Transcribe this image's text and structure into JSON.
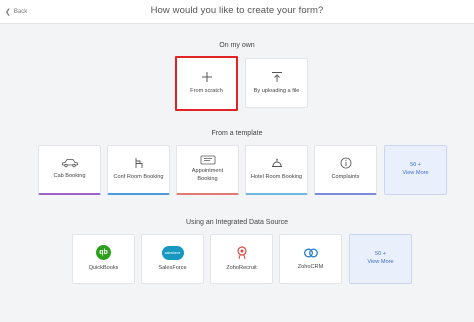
{
  "header": {
    "back_label": "Back",
    "title": "How would you like to create your form?"
  },
  "own": {
    "section_title": "On my own",
    "from_scratch": "From scratch",
    "upload": "By uploading a file"
  },
  "templates": {
    "section_title": "From a template",
    "items": [
      {
        "label": "Cab Booking",
        "icon": "car-icon"
      },
      {
        "label": "Conf Room Booking",
        "icon": "chair-icon"
      },
      {
        "label": "Appointment\nBooking",
        "icon": "ticket-icon"
      },
      {
        "label": "Hotel Room Booking",
        "icon": "bell-icon"
      },
      {
        "label": "Complaints",
        "icon": "info-icon"
      }
    ],
    "more_count": "50 +",
    "more_label": "View More"
  },
  "integrations": {
    "section_title": "Using an Integrated Data Source",
    "items": [
      {
        "label": "QuickBooks",
        "icon": "quickbooks-icon"
      },
      {
        "label": "SalesForce",
        "icon": "salesforce-icon"
      },
      {
        "label": "ZohoRecruit",
        "icon": "zohorecruit-icon"
      },
      {
        "label": "ZohoCRM",
        "icon": "zohocrm-icon"
      }
    ],
    "salesforce_logo_text": "salesforce",
    "qb_logo_text": "qb",
    "more_count": "50 +",
    "more_label": "View More"
  },
  "colors": {
    "selected_border": "#e02424",
    "more_bg": "#eaf0fb",
    "link_blue": "#3c6fd0"
  }
}
